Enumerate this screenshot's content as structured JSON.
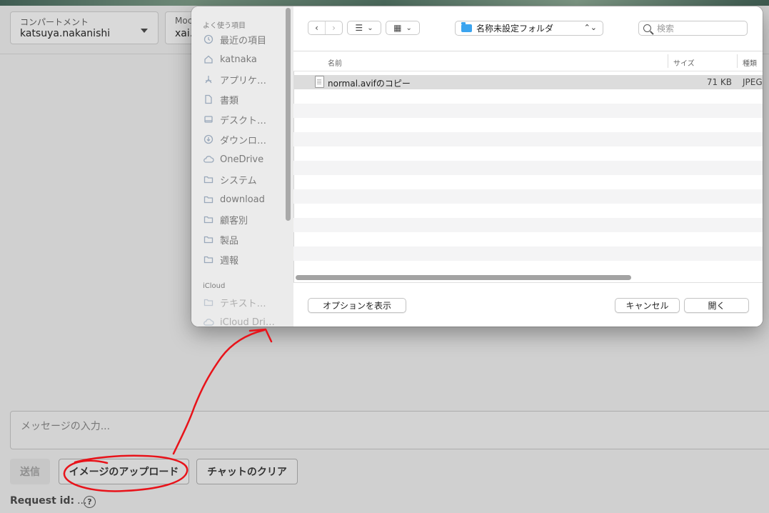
{
  "header": {
    "compartment_label": "コンパートメント",
    "compartment_value": "katsuya.nakanishi",
    "model_label": "Moc",
    "model_value": "xai."
  },
  "chat": {
    "message_placeholder": "メッセージの入力...",
    "send_label": "送信",
    "upload_label": "イメージのアップロード",
    "clear_label": "チャットのクリア",
    "request_id_label": "Request id:",
    "request_id_value": "...",
    "help_glyph": "?"
  },
  "dialog": {
    "sidebar": {
      "favorites_title": "よく使う項目",
      "favorites": [
        {
          "label": "最近の項目",
          "icon": "clock-icon"
        },
        {
          "label": "katnaka",
          "icon": "home-icon"
        },
        {
          "label": "アプリケ…",
          "icon": "apps-icon"
        },
        {
          "label": "書類",
          "icon": "document-icon"
        },
        {
          "label": "デスクト…",
          "icon": "desktop-icon"
        },
        {
          "label": "ダウンロ…",
          "icon": "download-icon"
        },
        {
          "label": "OneDrive",
          "icon": "cloud-icon"
        },
        {
          "label": "システム",
          "icon": "folder-icon"
        },
        {
          "label": "download",
          "icon": "folder-icon"
        },
        {
          "label": "顧客別",
          "icon": "folder-icon"
        },
        {
          "label": "製品",
          "icon": "folder-icon"
        },
        {
          "label": "週報",
          "icon": "folder-icon"
        }
      ],
      "icloud_title": "iCloud",
      "icloud": [
        {
          "label": "テキスト…",
          "icon": "folder-icon"
        },
        {
          "label": "iCloud Dri…",
          "icon": "cloud-icon"
        }
      ]
    },
    "toolbar": {
      "back_glyph": "‹",
      "forward_glyph": "›",
      "list_view_glyph": "☰",
      "grid_view_glyph": "▦",
      "dropdown_glyph": "⌄",
      "folder_name": "名称未設定フォルダ",
      "folder_updown_glyph": "⌃⌄",
      "search_placeholder": "検索"
    },
    "columns": {
      "name": "名前",
      "size": "サイズ",
      "kind": "種類"
    },
    "files": [
      {
        "name": "normal.avifのコピー",
        "size": "71 KB",
        "kind": "JPEG"
      }
    ],
    "buttons": {
      "options": "オプションを表示",
      "cancel": "キャンセル",
      "open": "開く"
    }
  },
  "colors": {
    "annotation_red": "#e8131a",
    "folder_blue": "#3ba4ef",
    "overlay_gray": "#d0d0d0"
  }
}
